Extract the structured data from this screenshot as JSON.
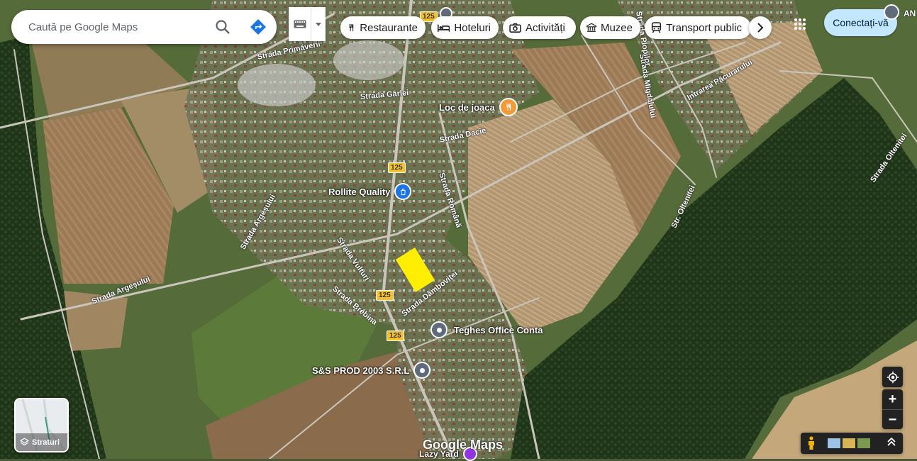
{
  "search": {
    "placeholder": "Caută pe Google Maps"
  },
  "categories": [
    {
      "label": "Restaurante",
      "icon": "fork-knife-icon"
    },
    {
      "label": "Hoteluri",
      "icon": "bed-icon"
    },
    {
      "label": "Activități",
      "icon": "camera-icon"
    },
    {
      "label": "Muzee",
      "icon": "museum-icon"
    },
    {
      "label": "Transport public",
      "icon": "train-icon"
    }
  ],
  "header": {
    "signin_label": "Conectați-vă",
    "account_partial": "AN"
  },
  "places": [
    {
      "name": "Loc de joaca",
      "icon": "restaurant-pin-icon"
    },
    {
      "name": "Rollite Quality",
      "icon": "shopping-pin-icon"
    },
    {
      "name": "Teghes Office Conta",
      "icon": "place-pin-icon"
    },
    {
      "name": "S&S PROD 2003 S.R.L",
      "icon": "place-pin-icon"
    },
    {
      "name": "Lazy Yard",
      "icon": "place-pin-icon"
    }
  ],
  "streets": [
    "Strada Primăverii",
    "Strada Gârlei",
    "Strada Dacie",
    "Strada Română",
    "Strada Argeșului",
    "Strada Argeșului",
    "Strada Vulturi",
    "Strada Brebina",
    "Strada Dâmboviței",
    "Str. Oltenitei",
    "Strada Migdalului",
    "Intrarea Păcurarului",
    "Strada Oltenitei",
    "Strada Plopilor"
  ],
  "road_shields": [
    "125",
    "125",
    "125",
    "125",
    "125"
  ],
  "layers": {
    "label": "Straturi"
  },
  "watermark": "Google Maps",
  "colors": {
    "highlight": "#ffee00",
    "signin_bg": "#c2e7ff",
    "control_dark": "#222222"
  }
}
